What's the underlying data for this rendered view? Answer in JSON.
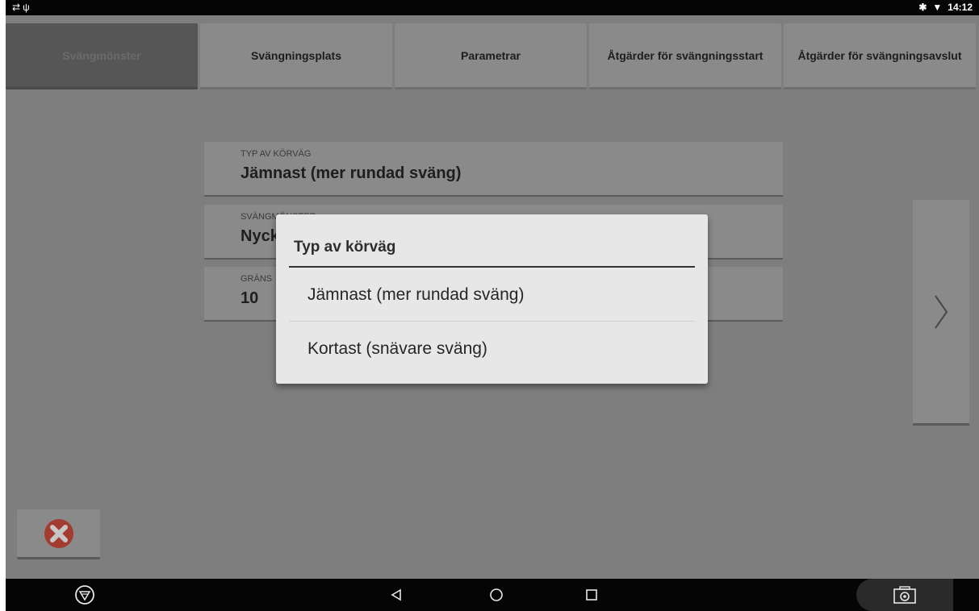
{
  "status": {
    "left_icons": [
      "signal-icon",
      "usb-icon"
    ],
    "time": "14:12"
  },
  "tabs": [
    {
      "label": "Svängmönster",
      "active": true
    },
    {
      "label": "Svängningsplats",
      "active": false
    },
    {
      "label": "Parametrar",
      "active": false
    },
    {
      "label": "Åtgärder för svängningsstart",
      "active": false
    },
    {
      "label": "Åtgärder för svängningsavslut",
      "active": false
    }
  ],
  "fields": [
    {
      "label": "TYP AV KÖRVÄG",
      "value": "Jämnast (mer rundad sväng)"
    },
    {
      "label": "SVÄNGMÖNSTER",
      "value": "Nyckelhål"
    },
    {
      "label": "GRÄNS",
      "value": "10"
    }
  ],
  "dialog": {
    "title": "Typ av körväg",
    "options": [
      "Jämnast (mer rundad sväng)",
      "Kortast (snävare sväng)"
    ]
  },
  "colors": {
    "accent_red": "#cf3a2a",
    "dim_bg": "#7e7e7e",
    "dialog_bg": "#e7e7e7"
  }
}
